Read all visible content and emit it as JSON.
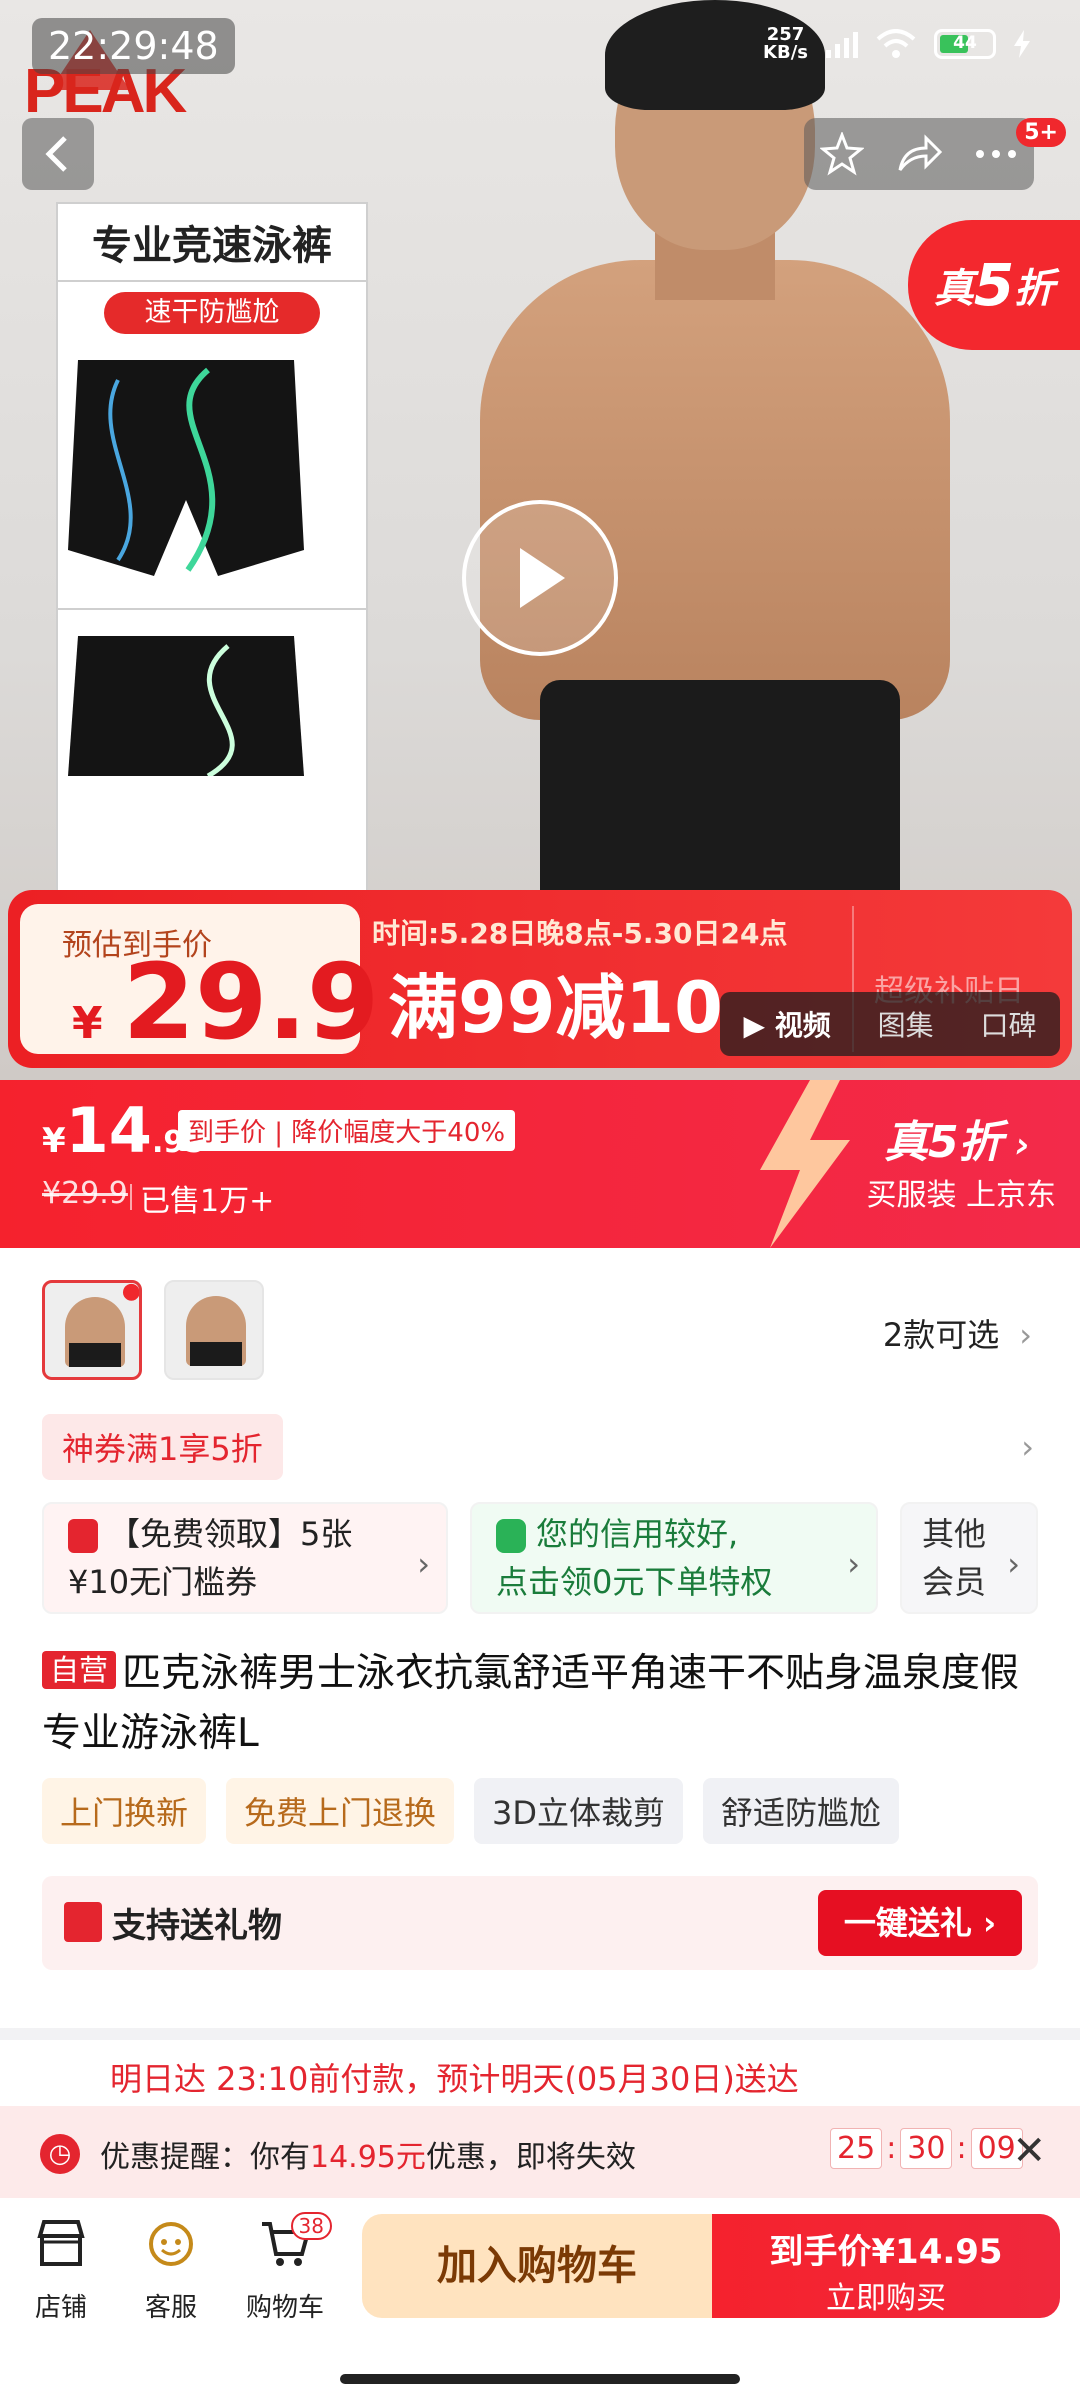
{
  "status_bar": {
    "time": "22:29:48",
    "net_speed": "257",
    "net_unit": "KB/s",
    "battery": "44"
  },
  "hero": {
    "brand": "PEAK",
    "badge_count": "5+",
    "card_title": "专业竞速泳裤",
    "card_tag": "速干防尴尬",
    "flag_prefix": "真",
    "flag_num": "5",
    "flag_suffix": "折",
    "promo": {
      "est_label": "预估到手价",
      "est_currency": "¥",
      "est_price": "29.9",
      "time": "时间:5.28日晚8点-5.30日24点",
      "main": "满99减10",
      "right": "超级补贴日"
    },
    "media_tabs": [
      "视频",
      "图集",
      "口碑"
    ]
  },
  "price_bar": {
    "currency": "¥",
    "price_int": "14",
    "price_dec": ".95",
    "tag": "到手价 | 降价幅度大于40%",
    "old_price": "¥29.9",
    "sold": "已售1万+",
    "right_prefix": "真",
    "right_num": "5",
    "right_suffix": "折",
    "right_sub": "买服装 上京东"
  },
  "variants": {
    "label": "2款可选"
  },
  "coupon": {
    "label": "神券满1享5折"
  },
  "cards": {
    "c1": {
      "line1": "【免费领取】5张",
      "line2": "¥10无门槛券"
    },
    "c2": {
      "line1": "您的信用较好,",
      "line2": "点击领0元下单特权"
    },
    "c3": {
      "line1": "其他",
      "line2": "会员"
    }
  },
  "product": {
    "self_tag": "自营",
    "title": "匹克泳裤男士泳衣抗氯舒适平角速干不贴身温泉度假专业游泳裤L"
  },
  "tags": [
    "上门换新",
    "免费上门退换",
    "3D立体裁剪",
    "舒适防尴尬"
  ],
  "gift": {
    "label": "支持送礼物",
    "button": "一键送礼 ›"
  },
  "delivery": {
    "text": "明日达 23:10前付款，预计明天(05月30日)送达"
  },
  "reminder": {
    "prefix": "优惠提醒：你有",
    "amount": "14.95元",
    "suffix": "优惠，即将失效",
    "h": "25",
    "m": "30",
    "s": "09"
  },
  "bottom": {
    "shop": "店铺",
    "service": "客服",
    "cart": "购物车",
    "cart_count": "38",
    "add_cart": "加入购物车",
    "buy_line1": "到手价¥14.95",
    "buy_line2": "立即购买"
  },
  "colors": {
    "brand_red": "#f5222d",
    "accent_orange": "#ffe3bf",
    "green": "#2ab257"
  }
}
